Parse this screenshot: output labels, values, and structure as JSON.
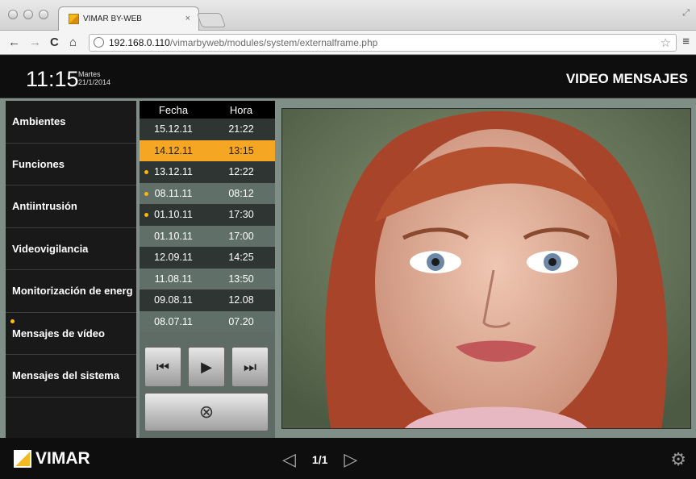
{
  "browser": {
    "tab_title": "VIMAR BY-WEB",
    "tab_close": "×",
    "url_host": "192.168.0.110",
    "url_path": "/vimarbyweb/modules/system/externalframe.php",
    "back": "←",
    "forward": "→",
    "reload": "C",
    "home": "⌂",
    "star": "☆",
    "menu": "≡"
  },
  "header": {
    "time": "11:15",
    "weekday": "Martes",
    "date": "21/1/2014",
    "title": "VIDEO MENSAJES"
  },
  "sidebar": {
    "items": [
      {
        "label": "Ambientes",
        "dot": false
      },
      {
        "label": "Funciones",
        "dot": false
      },
      {
        "label": "Antiintrusión",
        "dot": false
      },
      {
        "label": "Videovigilancia",
        "dot": false
      },
      {
        "label": "Monitorización de energ",
        "dot": false
      },
      {
        "label": "Mensajes de vídeo",
        "dot": true
      },
      {
        "label": "Mensajes del sistema",
        "dot": false
      }
    ]
  },
  "messages": {
    "col_date": "Fecha",
    "col_time": "Hora",
    "rows": [
      {
        "date": "15.12.11",
        "time": "21:22",
        "selected": false,
        "unread": false
      },
      {
        "date": "14.12.11",
        "time": "13:15",
        "selected": true,
        "unread": false
      },
      {
        "date": "13.12.11",
        "time": "12:22",
        "selected": false,
        "unread": true
      },
      {
        "date": "08.11.11",
        "time": "08:12",
        "selected": false,
        "unread": true
      },
      {
        "date": "01.10.11",
        "time": "17:30",
        "selected": false,
        "unread": true
      },
      {
        "date": "01.10.11",
        "time": "17:00",
        "selected": false,
        "unread": false
      },
      {
        "date": "12.09.11",
        "time": "14:25",
        "selected": false,
        "unread": false
      },
      {
        "date": "11.08.11",
        "time": "13:50",
        "selected": false,
        "unread": false
      },
      {
        "date": "09.08.11",
        "time": "12.08",
        "selected": false,
        "unread": false
      },
      {
        "date": "08.07.11",
        "time": "07.20",
        "selected": false,
        "unread": false
      }
    ]
  },
  "controls": {
    "prev": "⏮",
    "play": "▶",
    "next": "⏭",
    "delete": "⊗"
  },
  "footer": {
    "brand": "VIMAR",
    "page": "1/1"
  },
  "colors": {
    "accent": "#f5a623",
    "unread_dot": "#ffb400"
  }
}
